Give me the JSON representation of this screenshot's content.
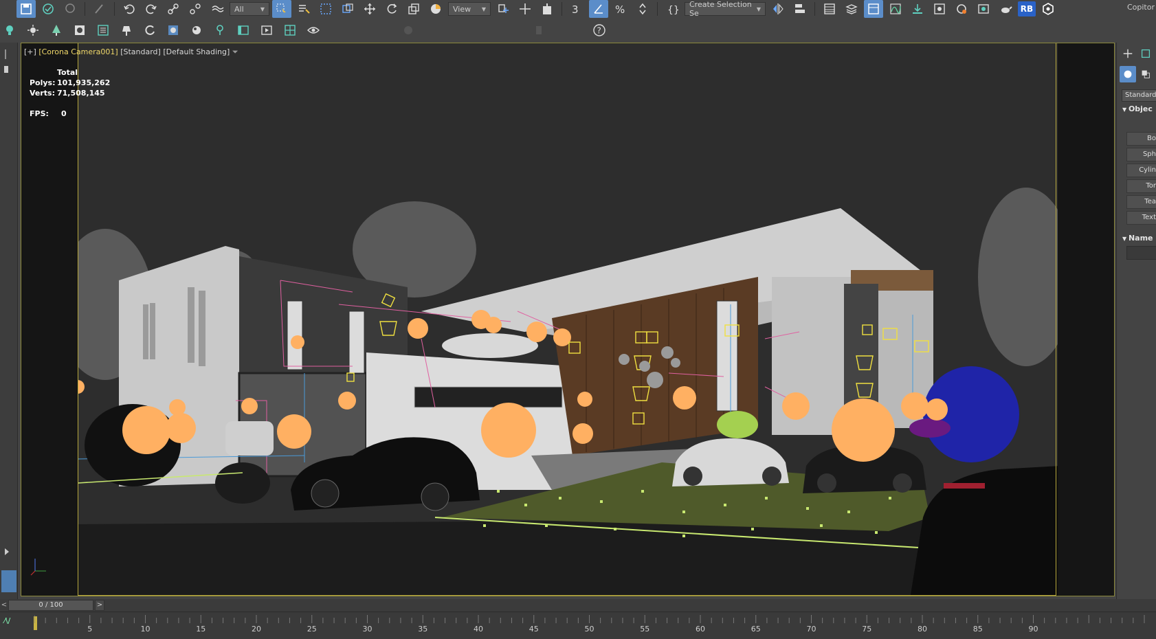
{
  "toolbar": {
    "selection_filter": "All",
    "ref_coord": "View",
    "named_selection": "Create Selection Se",
    "rb_label": "RB",
    "user_label": "Copitor"
  },
  "viewport": {
    "label_plus": "[+]",
    "label_camera": "[Corona Camera001]",
    "label_mode": "[Standard]",
    "label_shading": "[Default Shading]",
    "stats_header": "Total",
    "polys_label": "Polys:",
    "polys_value": "101,935,262",
    "verts_label": "Verts:",
    "verts_value": "71,508,145",
    "fps_label": "FPS:",
    "fps_value": "0"
  },
  "command_panel": {
    "category": "Standard",
    "section_object_type": "Objec",
    "buttons": [
      "Bo",
      "Sph",
      "Cylin",
      "Tor",
      "Tea",
      "Text"
    ],
    "section_name": "Name"
  },
  "timeline": {
    "current": "0 / 100",
    "prev": "<",
    "next": ">",
    "ticks": [
      5,
      10,
      15,
      20,
      25,
      30,
      35,
      40,
      45,
      50,
      55,
      60,
      65,
      70,
      75,
      80,
      85,
      90
    ],
    "curve_label": "⁄\\/"
  },
  "colors": {
    "accent_blue": "#5b8dc9",
    "light_orange": "#ffb062",
    "frame_yellow": "#b9a93e",
    "wire_yellow": "#f0e040",
    "wire_pink": "#e060a0",
    "foliage_green": "#c8e870"
  }
}
